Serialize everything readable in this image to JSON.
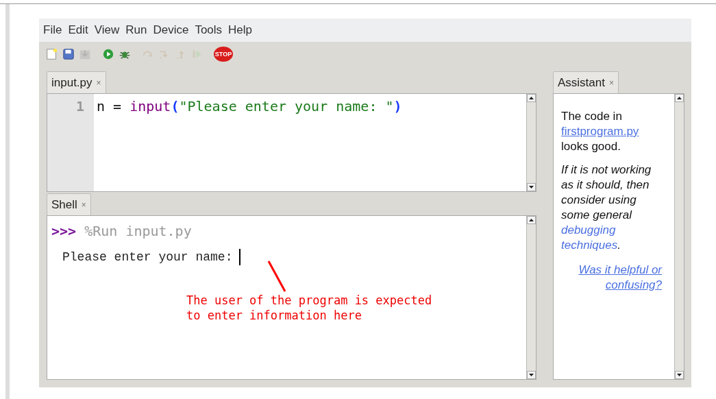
{
  "menu": [
    "File",
    "Edit",
    "View",
    "Run",
    "Device",
    "Tools",
    "Help"
  ],
  "toolbar": [
    {
      "kind": "new",
      "disabled": false
    },
    {
      "kind": "save",
      "disabled": false
    },
    {
      "kind": "load",
      "disabled": true
    },
    {
      "kind": "run",
      "disabled": false
    },
    {
      "kind": "debug",
      "disabled": false
    },
    {
      "kind": "step-over",
      "disabled": true
    },
    {
      "kind": "step-into",
      "disabled": true
    },
    {
      "kind": "step-out",
      "disabled": true
    },
    {
      "kind": "resume",
      "disabled": true
    },
    {
      "kind": "stop",
      "disabled": false,
      "label": "STOP"
    }
  ],
  "editor": {
    "tab": {
      "label": "input.py",
      "close": "×"
    },
    "lines": [
      {
        "number": "1",
        "tokens": [
          {
            "kind": "plain",
            "text": "n = "
          },
          {
            "kind": "builtin",
            "text": "input"
          },
          {
            "kind": "paren",
            "text": "("
          },
          {
            "kind": "string",
            "text": "\"Please enter your name: \""
          },
          {
            "kind": "paren",
            "text": ")"
          }
        ]
      }
    ]
  },
  "shell": {
    "tab": {
      "label": "Shell",
      "close": "×"
    },
    "prompt": ">>>",
    "command": "%Run input.py",
    "output": "Please enter your name:",
    "annotation": [
      "The user of the program is expected",
      "to enter information here"
    ]
  },
  "assistant": {
    "tab": {
      "label": "Assistant",
      "close": "×"
    },
    "para1": {
      "before": "The code in",
      "link": "firstprogram.py",
      "after": "looks good."
    },
    "para2": {
      "before": "If it is not working as it should, then consider using some general",
      "link": "debugging techniques",
      "after": "."
    },
    "feedback": "Was it helpful or confusing?"
  }
}
